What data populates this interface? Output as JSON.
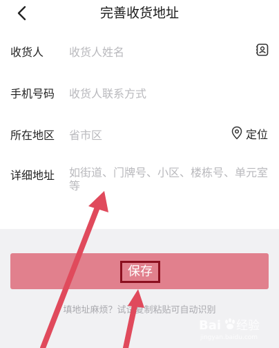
{
  "header": {
    "title": "完善收货地址",
    "back_icon": "chevron-left-icon"
  },
  "form": {
    "recipient": {
      "label": "收货人",
      "placeholder": "收货人姓名",
      "icon": "contact-book-icon"
    },
    "phone": {
      "label": "手机号码",
      "placeholder": "收货人联系方式"
    },
    "region": {
      "label": "所在地区",
      "placeholder": "省市区",
      "locate_label": "定位",
      "icon": "location-pin-icon"
    },
    "address": {
      "label": "详细地址",
      "placeholder": "如街道、门牌号、小区、楼栋号、单元室等"
    }
  },
  "save": {
    "label": "保存"
  },
  "hint": "填地址麻烦？试试复制粘贴可自动识别",
  "colors": {
    "save_button": "#e1808d",
    "annotation_arrow": "#e04a5c",
    "highlight_border": "#8b0f1f"
  }
}
